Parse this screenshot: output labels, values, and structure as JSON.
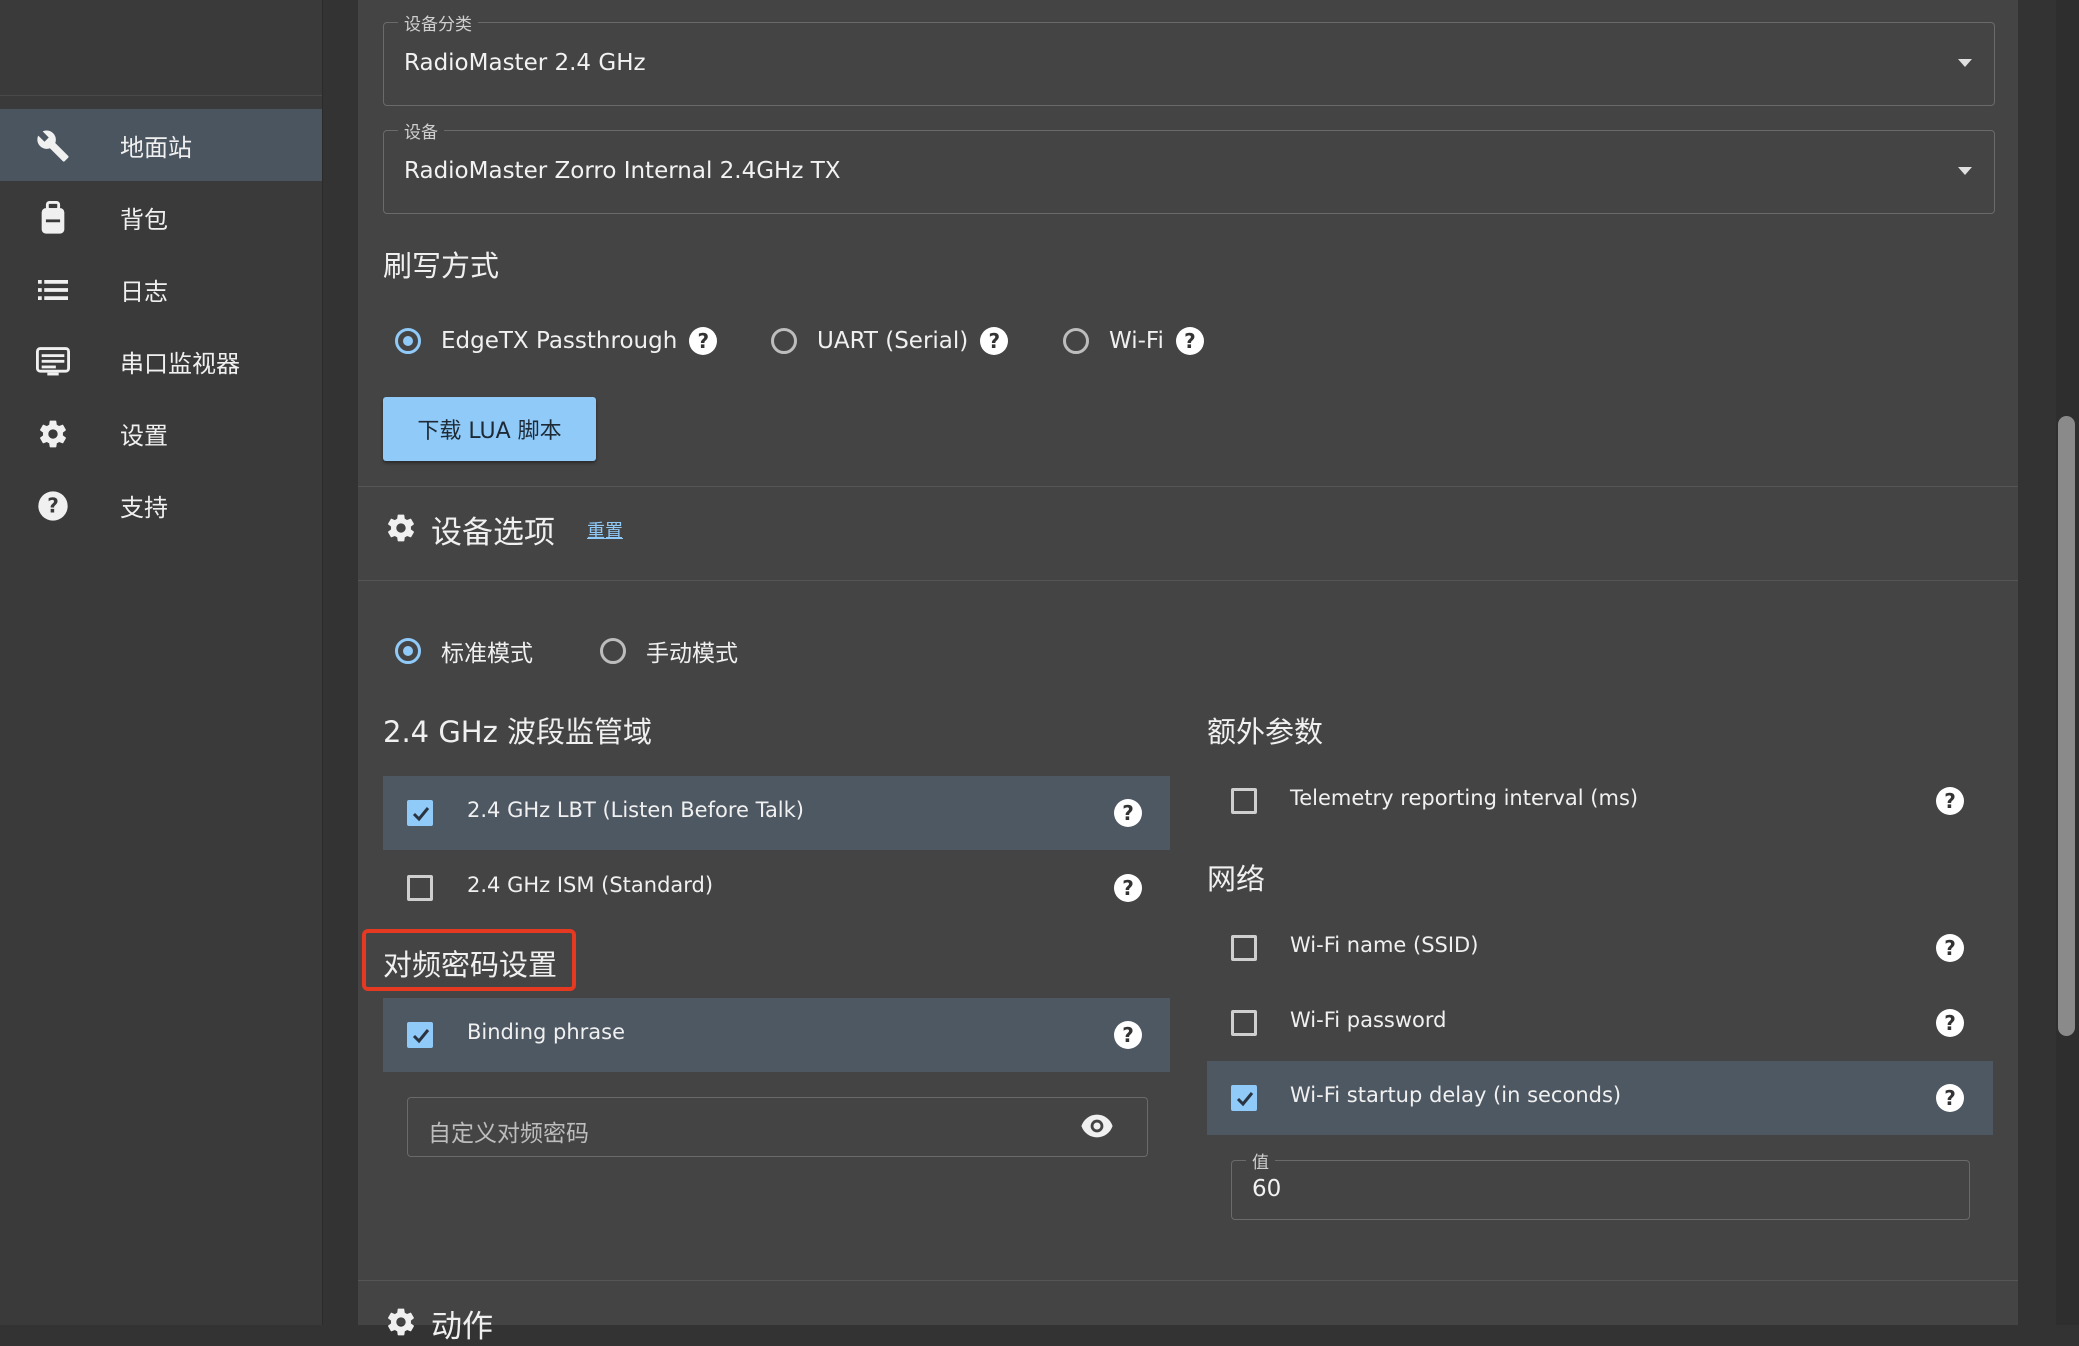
{
  "sidebar": {
    "items": [
      {
        "label": "地面站",
        "icon": "wrench-icon",
        "active": true
      },
      {
        "label": "背包",
        "icon": "backpack-icon",
        "active": false
      },
      {
        "label": "日志",
        "icon": "list-icon",
        "active": false
      },
      {
        "label": "串口监视器",
        "icon": "serial-monitor-icon",
        "active": false
      },
      {
        "label": "设置",
        "icon": "gear-icon",
        "active": false
      },
      {
        "label": "支持",
        "icon": "help-icon",
        "active": false
      }
    ]
  },
  "device_category": {
    "legend": "设备分类",
    "value": "RadioMaster 2.4 GHz"
  },
  "device": {
    "legend": "设备",
    "value": "RadioMaster Zorro Internal 2.4GHz TX"
  },
  "flash_method": {
    "title": "刷写方式",
    "options": [
      {
        "label": "EdgeTX Passthrough",
        "selected": true
      },
      {
        "label": "UART (Serial)",
        "selected": false
      },
      {
        "label": "Wi-Fi",
        "selected": false
      }
    ],
    "download_button": "下载 LUA 脚本"
  },
  "device_options": {
    "title": "设备选项",
    "reset_link": "重置",
    "modes": [
      {
        "label": "标准模式",
        "selected": true
      },
      {
        "label": "手动模式",
        "selected": false
      }
    ]
  },
  "regulatory": {
    "title": "2.4 GHz 波段监管域",
    "options": [
      {
        "label": "2.4 GHz LBT (Listen Before Talk)",
        "checked": true
      },
      {
        "label": "2.4 GHz ISM (Standard)",
        "checked": false
      }
    ]
  },
  "binding": {
    "title": "对频密码设置",
    "option": {
      "label": "Binding phrase",
      "checked": true
    },
    "input_placeholder": "自定义对频密码"
  },
  "extra_params": {
    "title": "额外参数",
    "options": [
      {
        "label": "Telemetry reporting interval (ms)",
        "checked": false
      }
    ]
  },
  "network": {
    "title": "网络",
    "options": [
      {
        "label": "Wi-Fi name (SSID)",
        "checked": false
      },
      {
        "label": "Wi-Fi password",
        "checked": false
      },
      {
        "label": "Wi-Fi startup delay (in seconds)",
        "checked": true
      }
    ],
    "value_field": {
      "legend": "值",
      "value": "60"
    }
  },
  "actions": {
    "title": "动作"
  },
  "colors": {
    "accent": "#90caf9",
    "highlight": "#e53922",
    "selected_row": "#4e5863"
  }
}
